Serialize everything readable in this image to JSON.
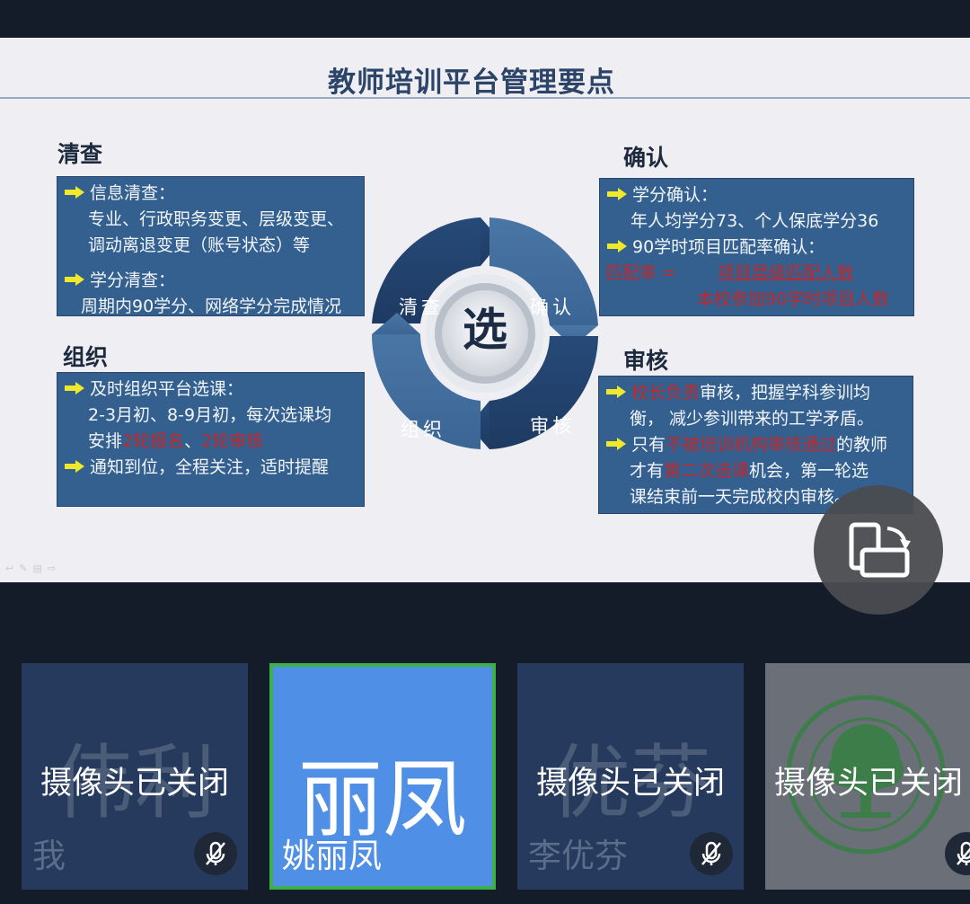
{
  "slide": {
    "title": "教师培训平台管理要点",
    "sections": {
      "check": {
        "heading": "清查",
        "items": [
          {
            "lead": "信息清查：",
            "lines": [
              "专业、行政职务变更、层级变更、",
              "调动离退变更（账号状态）等"
            ]
          },
          {
            "lead": "学分清查：",
            "lines": [
              "周期内90学分、网络学分完成情况"
            ]
          }
        ]
      },
      "confirm": {
        "heading": "确认",
        "items": [
          {
            "lead": "学分确认：",
            "lines": [
              "年人均学分73、个人保底学分36"
            ]
          },
          {
            "lead": "90学时项目匹配率确认："
          }
        ],
        "formula_label": "匹配率 =",
        "numerator": "项目层级匹配人数",
        "denominator": "本校参加90学时项目人数"
      },
      "organize": {
        "heading": "组织",
        "item1_lead": "及时组织平台选课：",
        "item1_line1": "2-3月初、8-9月初，每次选课均",
        "item1_line2_a": "安排",
        "item1_line2_red1": "2轮报名",
        "item1_line2_b": "、",
        "item1_line2_red2": "2轮审核",
        "item2_lead": "通知到位，全程关注，适时提醒"
      },
      "review": {
        "heading": "审核",
        "l1_red": "校长负责",
        "l1_rest": "审核，把握学科参训均",
        "l2": "衡， 减少参训带来的工学矛盾。",
        "l3_a": "只有",
        "l3_red": "不被培训机构审核通过",
        "l3_b": "的教师",
        "l4_a": "才有",
        "l4_red": "第二次选课",
        "l4_b": "机会，第一轮选",
        "l5": "课结束前一天完成校内审核。"
      }
    },
    "cycle": {
      "center": "选",
      "top_left": "清查",
      "top_right": "确认",
      "bottom_left": "组织",
      "bottom_right": "审核"
    }
  },
  "participants": [
    {
      "bg_name": "伟利",
      "status": "摄像头已关闭",
      "label": "我",
      "mic_muted": true
    },
    {
      "big_name": "丽凤",
      "label": "姚丽凤",
      "active": true
    },
    {
      "bg_name": "优芬",
      "status": "摄像头已关闭",
      "label": "李优芬",
      "mic_muted": true
    },
    {
      "status": "摄像头已关闭",
      "mic_muted": true,
      "logo": true
    }
  ],
  "colors": {
    "box_blue": "#34608f",
    "active_tile": "#4f8fe6",
    "active_border": "#3cb04a",
    "highlight_red": "#c0282c",
    "arrow_yellow": "#f0e82a"
  }
}
